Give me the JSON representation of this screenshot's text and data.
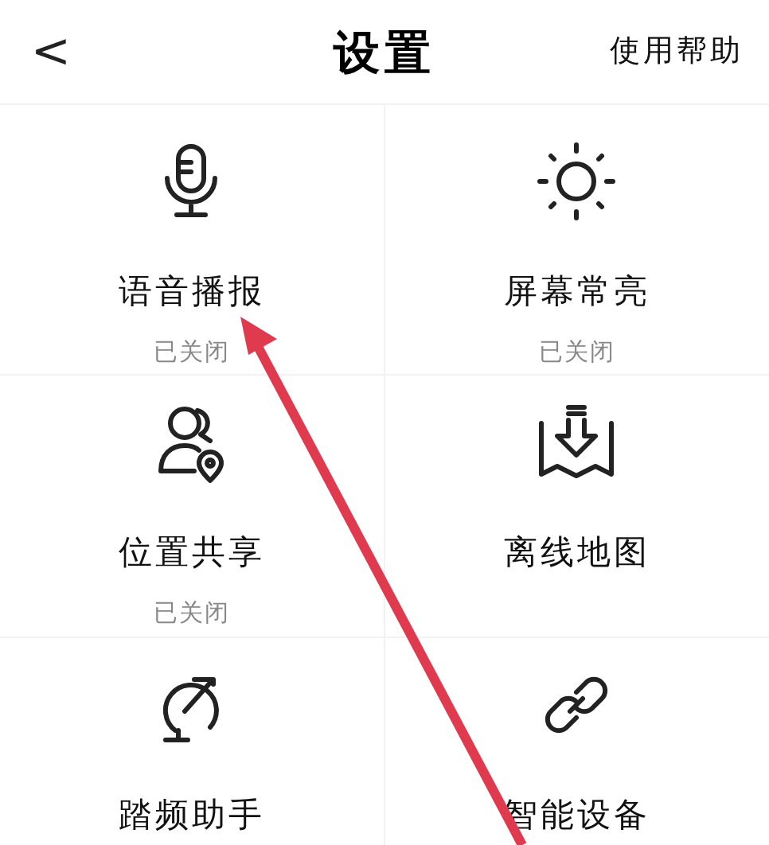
{
  "header": {
    "back": "<",
    "title": "设置",
    "help": "使用帮助"
  },
  "tiles": [
    {
      "label": "语音播报",
      "status": "已关闭"
    },
    {
      "label": "屏幕常亮",
      "status": "已关闭"
    },
    {
      "label": "位置共享",
      "status": "已关闭"
    },
    {
      "label": "离线地图"
    },
    {
      "label": "踏频助手"
    },
    {
      "label": "智能设备"
    }
  ]
}
